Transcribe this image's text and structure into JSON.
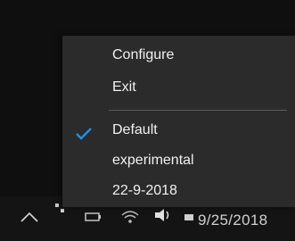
{
  "menu": {
    "items": [
      {
        "label": "Configure"
      },
      {
        "label": "Exit"
      },
      {
        "label": "Default",
        "checked": true
      },
      {
        "label": "experimental"
      },
      {
        "label": "22-9-2018"
      }
    ]
  },
  "taskbar": {
    "clock": "9/25/2018"
  },
  "colors": {
    "check": "#1e90e8",
    "menu_bg": "#2b2b2b",
    "text": "#f1f1f1"
  },
  "icons": [
    "chevron-up-icon",
    "network-icon",
    "speaker-icon",
    "notification-icon",
    "checkmark-icon"
  ]
}
